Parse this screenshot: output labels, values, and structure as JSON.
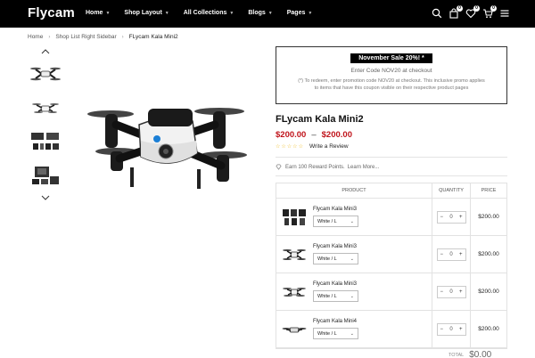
{
  "header": {
    "logo": "Flycam",
    "nav": [
      {
        "label": "Home"
      },
      {
        "label": "Shop Layout"
      },
      {
        "label": "All Collections"
      },
      {
        "label": "Blogs"
      },
      {
        "label": "Pages"
      }
    ],
    "icons": {
      "search": "search-icon",
      "bag_badge": "0",
      "wishlist_badge": "0",
      "cart_badge": "0"
    }
  },
  "breadcrumb": [
    "Home",
    "Shop List Right Sidebar",
    "FLycam Kala Mini2"
  ],
  "promo": {
    "title": "November Sale 20%! *",
    "code_text": "Enter Code NOV20 at checkout",
    "note": "(*) To redeem, enter promotion code NOV20 at checkout. This inclusive promo applies to items that have this coupon visible on their respective product pages"
  },
  "product": {
    "title": "FLycam Kala Mini2",
    "price_from": "$200.00",
    "price_dash": "–",
    "price_to": "$200.00",
    "rating_stars": 5,
    "review_link": "Write a Review",
    "reward_text": "Earn 100 Reward Points.",
    "reward_link": "Learn More..."
  },
  "table": {
    "headers": {
      "product": "PRODUCT",
      "quantity": "QUANTITY",
      "price": "PRICE"
    },
    "rows": [
      {
        "name": "Flycam Kala Mini3",
        "variant": "White / L",
        "qty": "0",
        "price": "$200.00"
      },
      {
        "name": "Flycam Kala Mini3",
        "variant": "White / L",
        "qty": "0",
        "price": "$200.00"
      },
      {
        "name": "Flycam Kala Mini3",
        "variant": "White / L",
        "qty": "0",
        "price": "$200.00"
      },
      {
        "name": "Flycam Kala Mini4",
        "variant": "White / L",
        "qty": "0",
        "price": "$200.00"
      }
    ],
    "total_label": "TOTAL",
    "total_value": "$0.00"
  },
  "colors": {
    "accent_price": "#c0141b",
    "star": "#f0c030",
    "header_bg": "#000000"
  }
}
